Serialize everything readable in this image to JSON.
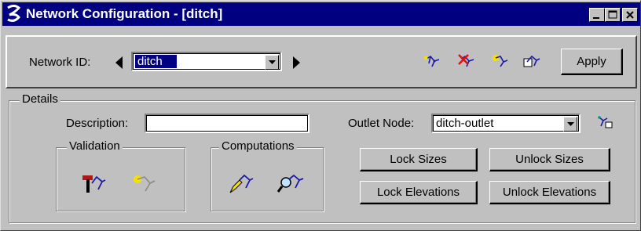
{
  "window": {
    "title": "Network Configuration - [ditch]",
    "controls": [
      "minimize-icon",
      "maximize-icon",
      "close-icon"
    ]
  },
  "header": {
    "network_id_label": "Network ID:",
    "network_id_value": "ditch",
    "prev_icon": "triangle-left-icon",
    "next_icon": "triangle-right-icon",
    "toolbar_icons": [
      "new-network-icon",
      "delete-network-icon",
      "highlight-network-icon",
      "network-properties-icon"
    ],
    "apply_label": "Apply"
  },
  "details": {
    "legend": "Details",
    "description_label": "Description:",
    "description_value": "",
    "outlet_label": "Outlet Node:",
    "outlet_value": "ditch-outlet",
    "outlet_pick_icon": "select-outlet-icon",
    "validation": {
      "legend": "Validation",
      "icons": [
        "validate-network-hammer-icon",
        "highlight-errors-icon"
      ]
    },
    "computations": {
      "legend": "Computations",
      "icons": [
        "compute-network-pencil-icon",
        "review-network-magnifier-icon"
      ]
    },
    "buttons": {
      "lock_sizes": "Lock Sizes",
      "unlock_sizes": "Unlock Sizes",
      "lock_elevations": "Lock Elevations",
      "unlock_elevations": "Unlock Elevations"
    }
  },
  "colors": {
    "titlebar": "#000080",
    "face": "#c0c0c0",
    "network_icon_blue": "#1a1aa8",
    "delete_red": "#e01010",
    "highlight_yellow": "#f5e000"
  }
}
